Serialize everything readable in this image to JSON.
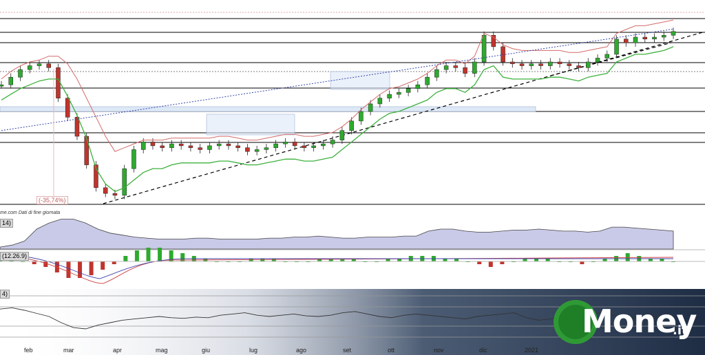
{
  "chart_data": [
    {
      "type": "candlestick",
      "title": "",
      "xlabel": "",
      "ylabel": "",
      "x_ticks": [
        "feb",
        "mar",
        "apr",
        "mag",
        "giu",
        "lug",
        "ago",
        "set",
        "ott",
        "nov",
        "dic",
        "2021"
      ],
      "annotations": [
        "(-35,74%)"
      ],
      "source_note": "me.com  Dati di fine giornata",
      "grid": true,
      "series": [
        {
          "kind": "close",
          "values": [
            62,
            66,
            70,
            72,
            73,
            71,
            55,
            45,
            35,
            20,
            8,
            5,
            4,
            18,
            28,
            32,
            30,
            29,
            31,
            30,
            29,
            28,
            30,
            31,
            30,
            29,
            27,
            28,
            29,
            31,
            32,
            30,
            29,
            30,
            31,
            33,
            38,
            43,
            48,
            52,
            55,
            57,
            58,
            60,
            62,
            66,
            70,
            72,
            71,
            68,
            74,
            88,
            82,
            74,
            73,
            72,
            73,
            72,
            74,
            73,
            72,
            71,
            74,
            76,
            78,
            86,
            84,
            87,
            86,
            87,
            88,
            90
          ]
        },
        {
          "kind": "stop",
          "values": [
            58,
            61,
            64,
            66,
            68,
            69,
            69,
            60,
            50,
            38,
            22,
            14,
            10,
            12,
            16,
            20,
            22,
            22,
            24,
            25,
            25,
            25,
            25,
            26,
            26,
            25,
            24,
            24,
            25,
            26,
            27,
            27,
            26,
            26,
            27,
            28,
            32,
            36,
            40,
            44,
            48,
            51,
            52,
            54,
            56,
            58,
            62,
            64,
            64,
            62,
            66,
            74,
            76,
            70,
            69,
            69,
            69,
            69,
            70,
            70,
            69,
            68,
            70,
            71,
            72,
            78,
            80,
            82,
            82,
            83,
            84,
            86
          ]
        },
        {
          "kind": "resistance",
          "values": [
            60,
            64,
            67,
            69,
            70,
            72,
            72,
            68,
            60,
            50,
            40,
            30,
            22,
            24,
            26,
            28,
            28,
            28,
            29,
            29,
            29,
            29,
            29,
            30,
            30,
            29,
            28,
            28,
            29,
            30,
            31,
            31,
            30,
            30,
            31,
            32,
            35,
            39,
            44,
            48,
            52,
            55,
            56,
            58,
            60,
            63,
            67,
            70,
            70,
            68,
            72,
            84,
            82,
            78,
            76,
            75,
            75,
            75,
            75,
            75,
            74,
            74,
            75,
            76,
            77,
            84,
            86,
            88,
            88,
            89,
            90,
            91
          ]
        }
      ]
    },
    {
      "type": "area",
      "label": "14)",
      "values": [
        2,
        4,
        8,
        20,
        26,
        30,
        30,
        26,
        20,
        16,
        14,
        12,
        11,
        10,
        10,
        10,
        11,
        11,
        10,
        10,
        10,
        10,
        11,
        11,
        12,
        12,
        13,
        12,
        11,
        11,
        12,
        12,
        12,
        13,
        13,
        18,
        20,
        20,
        18,
        17,
        17,
        18,
        19,
        19,
        20,
        19,
        18,
        18,
        17,
        18,
        22,
        22,
        21,
        20,
        19,
        18
      ]
    },
    {
      "type": "histogram",
      "label": "(12.26.9)",
      "values": [
        1,
        1,
        0,
        -1,
        -2,
        -4,
        -6,
        -6,
        -5,
        -3,
        -1,
        2,
        4,
        5,
        5,
        4,
        3,
        2,
        1,
        0,
        0,
        0,
        1,
        1,
        1,
        0,
        0,
        0,
        1,
        1,
        1,
        1,
        0,
        0,
        1,
        1,
        2,
        2,
        2,
        1,
        1,
        0,
        -1,
        -2,
        -1,
        0,
        1,
        1,
        1,
        0,
        0,
        -1,
        0,
        1,
        2,
        3,
        2,
        1,
        1,
        0
      ]
    },
    {
      "type": "line",
      "label": "4)",
      "values": [
        62,
        64,
        60,
        55,
        50,
        40,
        32,
        30,
        36,
        40,
        44,
        46,
        48,
        50,
        48,
        47,
        49,
        48,
        52,
        54,
        56,
        52,
        50,
        52,
        54,
        51,
        50,
        52,
        56,
        58,
        54,
        50,
        48,
        52,
        54,
        52,
        50,
        48,
        46,
        50,
        52,
        54,
        56,
        48,
        44,
        46,
        50,
        52,
        54,
        56,
        52,
        50,
        48,
        52,
        50,
        54
      ]
    }
  ],
  "logo": {
    "text": "Money",
    "suffix": ".it",
    "mark": "M"
  },
  "colors": {
    "up": "#2eaa2e",
    "down": "#c0342c",
    "stop": "#3cb03c",
    "ma": "#3344aa",
    "resist": "#d46a6a",
    "brand": "#2f9a35"
  }
}
